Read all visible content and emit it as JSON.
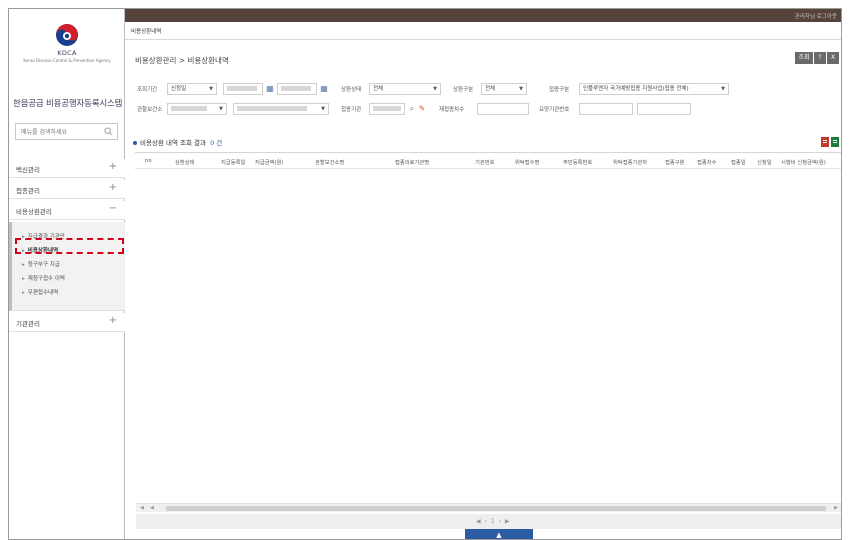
{
  "logo": {
    "abbr": "KDCA",
    "name_en": "Korea Disease Control & Prevention Agency"
  },
  "sidebar": {
    "system_title": "한음공급 비용공행자동록시스템",
    "search_placeholder": "메뉴를 검색하세요",
    "menus": [
      {
        "label": "백신관리",
        "toggle": "+"
      },
      {
        "label": "접종관리",
        "toggle": "+"
      },
      {
        "label": "비용상환관리",
        "toggle": "−"
      },
      {
        "label": "기관관리",
        "toggle": "+"
      }
    ],
    "sub_items": [
      {
        "label": "지급결과 기관안",
        "active": false
      },
      {
        "label": "비용상환내역",
        "active": true
      },
      {
        "label": "청구부구 지급",
        "active": false
      },
      {
        "label": "재청구접수 이력",
        "active": false
      },
      {
        "label": "우편접수내역",
        "active": false
      }
    ]
  },
  "tab": {
    "label": "비용상환내역"
  },
  "breadcrumb": "비용상환관리 > 비용상환내역",
  "window_buttons": {
    "a": "조회",
    "b": "?",
    "c": "X"
  },
  "filters": {
    "r1": {
      "l1": "조회기간",
      "v1": "신청일",
      "l2": "상환상태",
      "v2": "전체",
      "l3": "상환구분",
      "v3": "전체",
      "l4": "접종구분",
      "v4": "인플루엔자 국가예방접종 지원사업(접종 전체)"
    },
    "r2": {
      "l1": "관할보건소",
      "l2": "접종기관",
      "l3": "재접종차수",
      "l4": "요양기관번호"
    }
  },
  "section": {
    "title": "비용상환 내역 조회 결과",
    "count": "0 건"
  },
  "grid": {
    "headers": [
      "no",
      "상환상태",
      "지급등록일",
      "지급금액(원)",
      "관할보건소명",
      "접종의료기관명",
      "기관번호",
      "위탁접수명",
      "주민등록번호",
      "위탁접종기관자",
      "접종구분",
      "접종차수",
      "접종일",
      "신청일",
      "시행비 신청금액(원)"
    ]
  },
  "pager": "◀ ‹ 1 › ▶",
  "up_button": "▲",
  "topbar": {
    "user": "관리자님 로그아웃"
  },
  "colors": {
    "topbar": "#55423a",
    "accent": "#2b5ca3",
    "highlight_box": "#d0021b"
  }
}
